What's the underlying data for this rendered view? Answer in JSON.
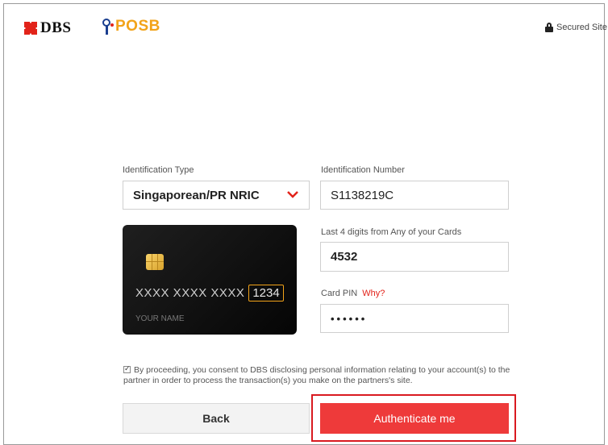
{
  "header": {
    "dbs_logo_text": "DBS",
    "posb_logo_text": "POSB",
    "secured_text": "Secured Site"
  },
  "form": {
    "id_type_label": "Identification Type",
    "id_type_value": "Singaporean/PR NRIC",
    "id_number_label": "Identification Number",
    "id_number_value": "S1138219C",
    "last4_label": "Last 4 digits from Any of your Cards",
    "last4_value": "4532",
    "pin_label": "Card PIN",
    "pin_why": "Why?",
    "pin_value": "••••••"
  },
  "card": {
    "masked_number": "XXXX XXXX XXXX",
    "last4_placeholder": "1234",
    "name_placeholder": "YOUR NAME"
  },
  "consent": {
    "text": "By proceeding, you consent to DBS disclosing personal information relating to your account(s) to the partner in order to process the transaction(s) you make on the partners's site."
  },
  "buttons": {
    "back": "Back",
    "authenticate": "Authenticate me"
  },
  "colors": {
    "brand_red": "#e2231a",
    "button_red": "#ee3a3a",
    "posb_orange": "#f2a319",
    "posb_blue": "#1a3e8f"
  }
}
